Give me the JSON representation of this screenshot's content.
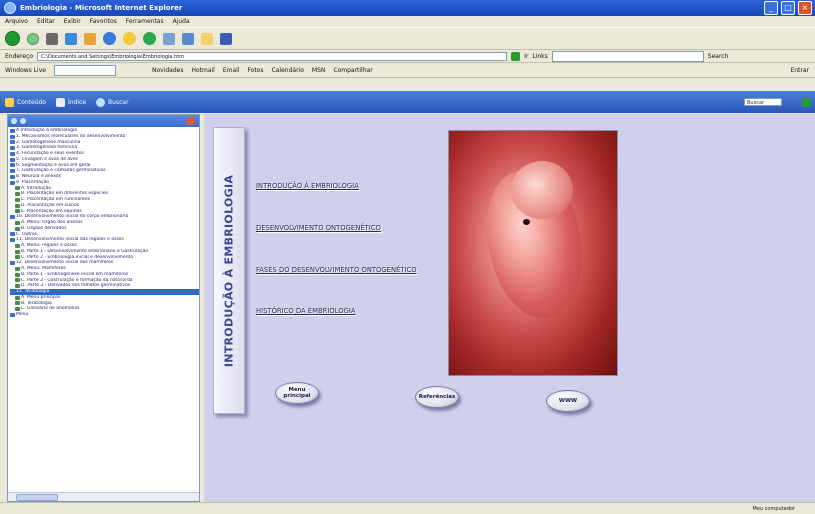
{
  "window": {
    "title": "Embriologia - Microsoft Internet Explorer"
  },
  "menubar": {
    "items": [
      "Arquivo",
      "Editar",
      "Exibir",
      "Favoritos",
      "Ferramentas",
      "Ajuda"
    ]
  },
  "addressbar": {
    "label": "Endereço",
    "url": "C:\\Documents and Settings\\Embriologia\\Embriologia.htm",
    "go_label": "Ir",
    "links_label": "Links",
    "search_label": "Search"
  },
  "linksbar": {
    "brand": "Windows Live",
    "items": [
      "Novidades",
      "Hotmail",
      "Email",
      "Fotos",
      "Calendário",
      "MSN",
      "Compartilhar"
    ],
    "right_label": "Entrar"
  },
  "chm": {
    "tabs": [
      "Conteúdo",
      "Índice",
      "Buscar"
    ],
    "search_placeholder": "Buscar"
  },
  "sidebar": {
    "items": [
      {
        "label": "A Introdução à embriologia",
        "level": 0
      },
      {
        "label": "1. Mecanismos moleculares do desenvolvimento",
        "level": 0
      },
      {
        "label": "2. Gametogênese masculina",
        "level": 0
      },
      {
        "label": "3. Gametogênese feminina",
        "level": 0
      },
      {
        "label": "4. Fecundação e seus eventos",
        "level": 0
      },
      {
        "label": "5. Clivagem e ovos de aves",
        "level": 0
      },
      {
        "label": "6. Segmentação e ovos em geral",
        "level": 0
      },
      {
        "label": "7. Gastrulação e camadas germinativas",
        "level": 0
      },
      {
        "label": "8. Nêurula e anexos",
        "level": 0
      },
      {
        "label": "9. Placentação",
        "level": 0
      },
      {
        "label": "A. Introdução",
        "level": 1
      },
      {
        "label": "B. Placentação em diferentes espécies",
        "level": 1
      },
      {
        "label": "C. Placentação em ruminantes",
        "level": 1
      },
      {
        "label": "D. Placentação em suínos",
        "level": 1
      },
      {
        "label": "E. Placentação em equinos",
        "level": 1
      },
      {
        "label": "10. Desenvolvimento inicial do corpo embrionário",
        "level": 0
      },
      {
        "label": "A. Menu: Órgão dos anexos",
        "level": 1
      },
      {
        "label": "B. Órgãos derivados",
        "level": 1
      },
      {
        "label": "C. Outros",
        "level": 0
      },
      {
        "label": "11. Desenvolvimento inicial das regiões e ossos",
        "level": 0
      },
      {
        "label": "A. Menu: regiões e ossos",
        "level": 1
      },
      {
        "label": "B. Parte 1 - Desenvolvimento embrionário e Gastrulação",
        "level": 1
      },
      {
        "label": "C. Parte 2 - Embriologia inicial e desenvolvimento",
        "level": 1
      },
      {
        "label": "12. Desenvolvimento inicial dos mamíferos",
        "level": 0
      },
      {
        "label": "A. Menu: Mamíferos",
        "level": 1
      },
      {
        "label": "B. Parte 1 - Embriogênese inicial em mamíferos",
        "level": 1
      },
      {
        "label": "C. Parte 2 - Gastrulação e formação da notocorda",
        "level": 1
      },
      {
        "label": "D. Parte 3 - Derivados dos folhetos germinativos",
        "level": 1
      },
      {
        "label": "13. Teratologia",
        "level": 0,
        "selected": true
      },
      {
        "label": "A. Menu principal",
        "level": 1
      },
      {
        "label": "B. Teratologia",
        "level": 1
      },
      {
        "label": "C. Glossário de anomalias",
        "level": 1
      },
      {
        "label": "Menu",
        "level": 0
      }
    ]
  },
  "content": {
    "vertical_title": "INTRODUÇÃO À EMBRIOLOGIA",
    "links": [
      "INTRODUÇÃO À EMBRIOLOGIA",
      "DESENVOLVIMENTO ONTOGENÉTICO",
      "FASES DO DESENVOLVIMENTO ONTOGENÉTICO",
      "HISTÓRICO DA EMBRIOLOGIA"
    ],
    "buttons": {
      "menu": "Menu principal",
      "refs": "Referências",
      "www": "WWW"
    }
  },
  "statusbar": {
    "zone": "Meu computador"
  }
}
